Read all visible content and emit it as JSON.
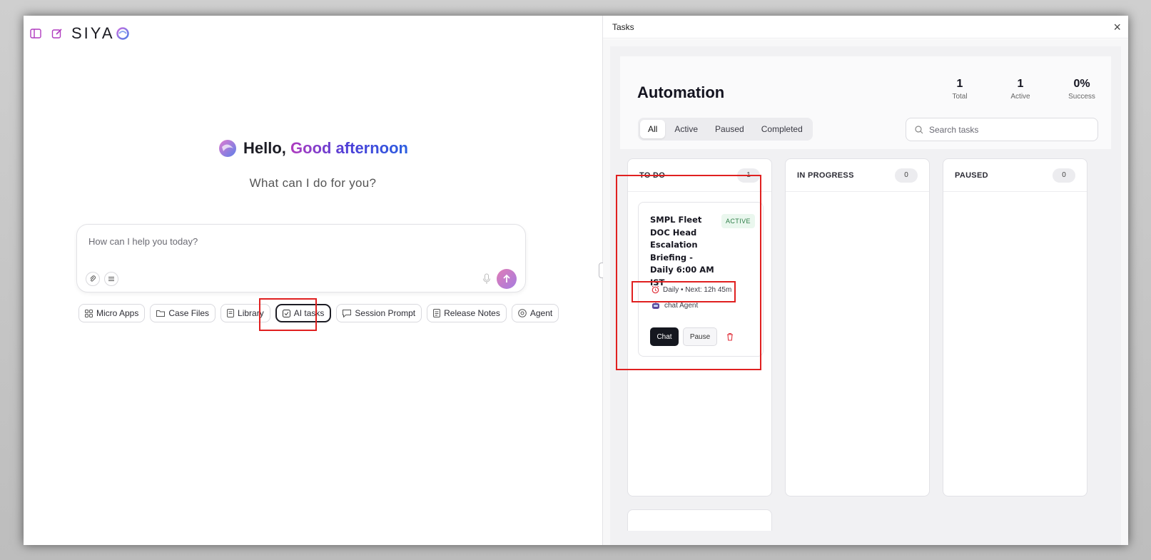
{
  "brand": {
    "name": "SIYA"
  },
  "greeting": {
    "hello": "Hello,",
    "time_of_day": "Good afternoon",
    "subtitle": "What can I do for you?"
  },
  "composer": {
    "placeholder": "How can I help you today?"
  },
  "chips": [
    {
      "label": "Micro Apps",
      "icon": "grid-icon"
    },
    {
      "label": "Case Files",
      "icon": "folder-icon"
    },
    {
      "label": "Library",
      "icon": "document-icon"
    },
    {
      "label": "AI tasks",
      "icon": "checkbox-icon",
      "active": true
    },
    {
      "label": "Session Prompt",
      "icon": "chat-bubble-icon"
    },
    {
      "label": "Release Notes",
      "icon": "notes-icon"
    },
    {
      "label": "Agent",
      "icon": "agent-icon"
    }
  ],
  "panel": {
    "title": "Tasks",
    "close_glyph": "×",
    "heading": "Automation",
    "stats": [
      {
        "value": "1",
        "label": "Total"
      },
      {
        "value": "1",
        "label": "Active"
      },
      {
        "value": "0%",
        "label": "Success"
      }
    ],
    "filters": [
      "All",
      "Active",
      "Paused",
      "Completed"
    ],
    "selected_filter": "All",
    "search_placeholder": "Search tasks",
    "columns": [
      {
        "name": "TO DO",
        "count": "1"
      },
      {
        "name": "IN PROGRESS",
        "count": "0"
      },
      {
        "name": "PAUSED",
        "count": "0"
      }
    ],
    "task": {
      "title": "SMPL Fleet DOC Head Escalation Briefing - Daily 6:00 AM IST",
      "status": "ACTIVE",
      "schedule": "Daily • Next: 12h 45m",
      "agent": "chat Agent",
      "chat_label": "Chat",
      "pause_label": "Pause"
    }
  },
  "colors": {
    "accent_gradient_start": "#b03cbf",
    "accent_gradient_end": "#2b5fe0",
    "highlight": "#e02020",
    "active_badge": "#2c7d46",
    "delete": "#e0323c"
  }
}
